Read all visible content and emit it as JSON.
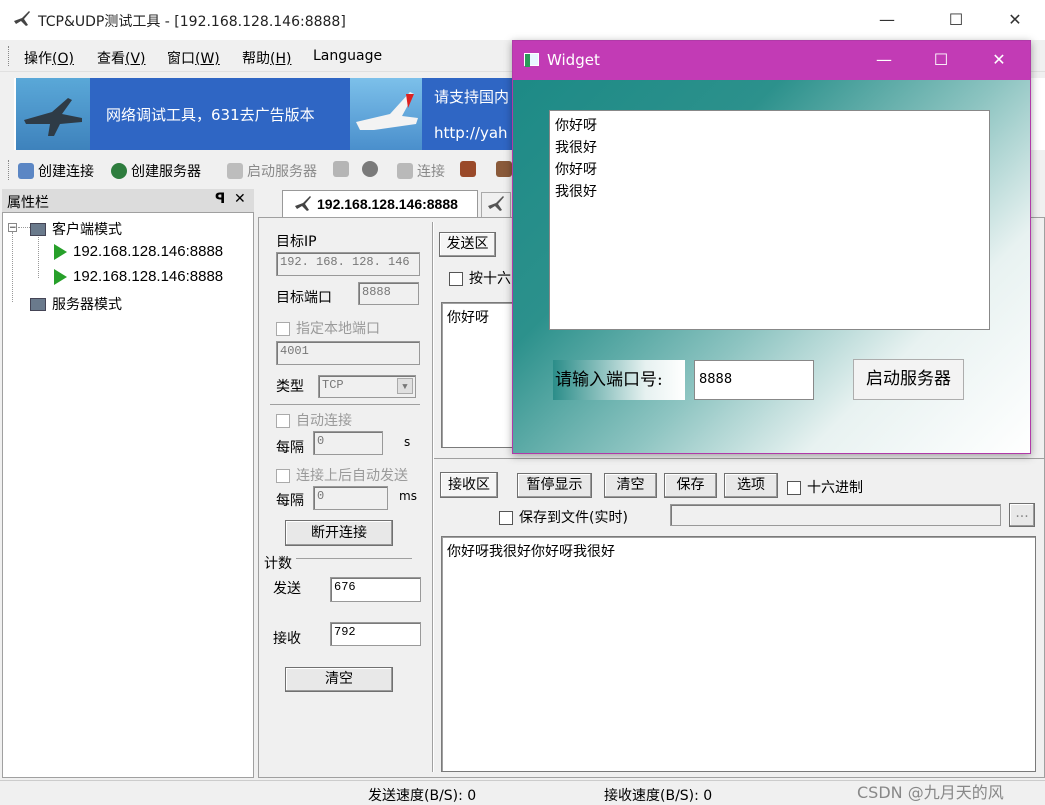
{
  "window": {
    "title": "TCP&UDP测试工具 - [192.168.128.146:8888]",
    "minimize": "—",
    "maximize": "☐",
    "close": "✕"
  },
  "menu": [
    {
      "text": "操作",
      "key": "(O)"
    },
    {
      "text": "查看",
      "key": "(V)"
    },
    {
      "text": "窗口",
      "key": "(W)"
    },
    {
      "text": "帮助",
      "key": "(H)"
    },
    {
      "text": "Language",
      "key": ""
    }
  ],
  "banner": {
    "ad_text": "网络调试工具，631去广告版本",
    "support_text": "请支持国内",
    "url_text": "http://yah"
  },
  "toolbar": {
    "create_connection": "创建连接",
    "create_server": "创建服务器",
    "start_server": "启动服务器",
    "connect": "连接"
  },
  "property_pane": {
    "title": "属性栏",
    "pin": "ᵖ",
    "close": "✕",
    "tree": {
      "client_mode": "客户端模式",
      "connections": [
        "192.168.128.146:8888",
        "192.168.128.146:8888"
      ],
      "server_mode": "服务器模式"
    }
  },
  "tabs": {
    "active": "192.168.128.146:8888"
  },
  "settings": {
    "target_ip_label": "目标IP",
    "target_ip": "192. 168. 128. 146",
    "target_port_label": "目标端口",
    "target_port": "8888",
    "local_port_label": "指定本地端口",
    "local_port": "4001",
    "type_label": "类型",
    "type_value": "TCP",
    "auto_connect_label": "自动连接",
    "every_label": "每隔",
    "interval_s": "0",
    "unit_s": "s",
    "auto_send_label": "连接上后自动发送",
    "interval_ms": "0",
    "unit_ms": "ms",
    "disconnect_button": "断开连接",
    "count_label": "计数",
    "send_label": "发送",
    "send_count": "676",
    "recv_label": "接收",
    "recv_count": "792",
    "clear_button": "清空"
  },
  "send_area": {
    "label": "发送区",
    "hex_label": "按十六",
    "content": "你好呀"
  },
  "recv_area": {
    "label": "接收区",
    "pause_button": "暂停显示",
    "clear_button": "清空",
    "save_button": "保存",
    "options_button": "选项",
    "hex_label": "十六进制",
    "save_file_label": "保存到文件(实时)",
    "browse_button": "...",
    "content": "你好呀我很好你好呀我很好"
  },
  "status": {
    "send_speed": "发送速度(B/S): 0",
    "recv_speed": "接收速度(B/S): 0",
    "watermark": "CSDN @九月天的风"
  },
  "widget": {
    "title": "Widget",
    "minimize": "—",
    "maximize": "☐",
    "close": "✕",
    "messages": [
      "你好呀",
      "我很好",
      "你好呀",
      "我很好"
    ],
    "port_label": "请输入端口号:",
    "port_value": "8888",
    "start_button": "启动服务器"
  }
}
